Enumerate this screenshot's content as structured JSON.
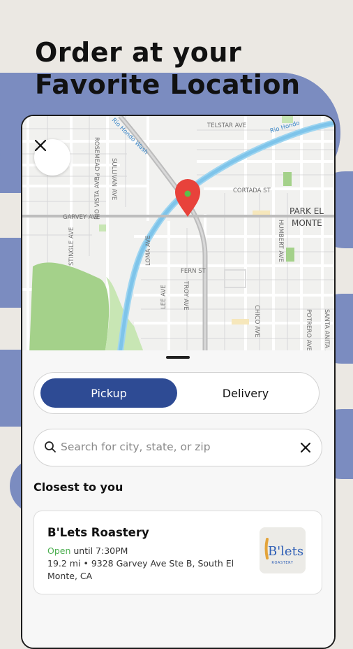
{
  "headline": {
    "line1": "Order at your",
    "line2": "Favorite Location"
  },
  "map": {
    "streets": {
      "telstar": "TELSTAR AVE",
      "rio_hondo": "Rio Hondo",
      "rio_hondo_wash": "Rio Hondo Wash",
      "cortada": "CORTADA ST",
      "garvey": "GARVEY AVE",
      "rosemead": "ROSEMEAD PL",
      "sullivan": "SULLIVAN AVE",
      "rio_vista": "RIO VISTA AVE",
      "stingle": "STINGLE AVE",
      "loma": "LOMA AVE",
      "fern": "FERN ST",
      "lee": "LEE AVE",
      "troy": "TROY AVE",
      "humbert": "HUMBERT AVE",
      "chico": "CHICO AVE",
      "potrero": "POTRERO AVE",
      "santa_anita": "SANTA ANITA AVE"
    },
    "place_label_1": "PARK EL",
    "place_label_2": "MONTE",
    "pin_color": "#e8423b"
  },
  "sheet": {
    "toggle": {
      "pickup_label": "Pickup",
      "delivery_label": "Delivery",
      "selected": "Pickup",
      "accent": "#2e4b94"
    },
    "search": {
      "placeholder": "Search for city, state, or zip",
      "value": ""
    },
    "section_title": "Closest to you",
    "stores": [
      {
        "name": "B'Lets Roastery",
        "status": "Open",
        "hours": "until 7:30PM",
        "distance": "19.2 mi",
        "separator": "•",
        "address": "9328 Garvey Ave Ste B, South El Monte, CA",
        "logo_text": "B'lets",
        "logo_subtext": "ROASTERY"
      }
    ]
  }
}
